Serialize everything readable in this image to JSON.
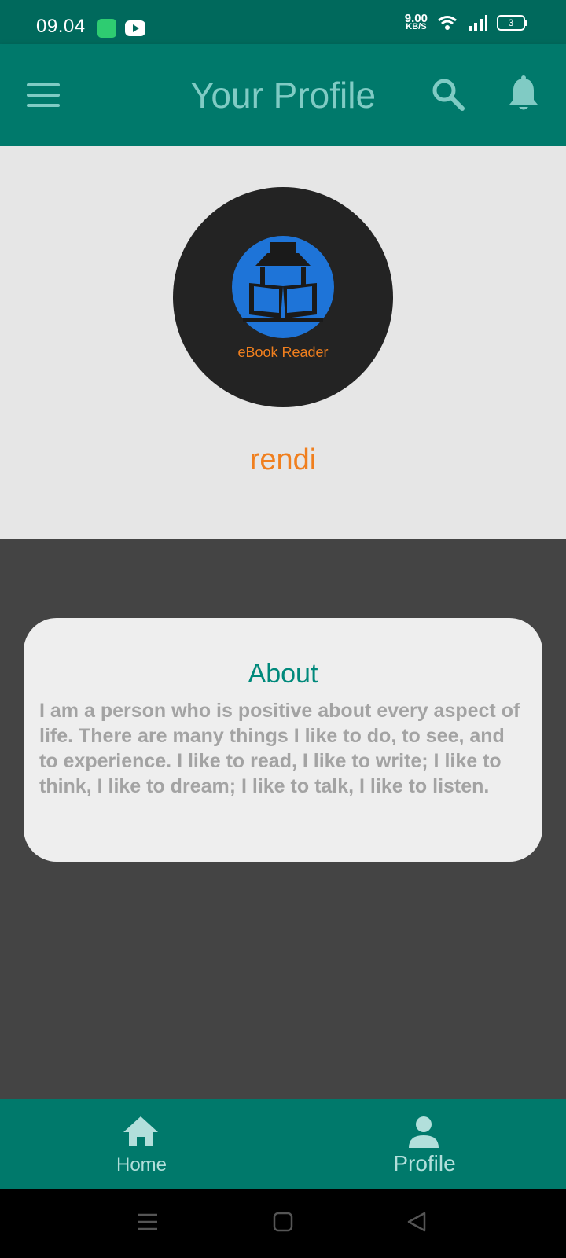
{
  "status_bar": {
    "time": "09.04",
    "net_speed_value": "9.00",
    "net_speed_unit": "KB/S",
    "battery": "3"
  },
  "app_bar": {
    "title": "Your Profile",
    "icons": [
      "menu-icon",
      "search-icon",
      "bell-icon"
    ]
  },
  "profile": {
    "avatar_caption": "eBook Reader",
    "username": "rendi"
  },
  "about": {
    "title": "About",
    "text": "I am a person who is positive about every aspect of life. There are many things I like to do, to see, and to experience. I like to read, I like to write; I like to think, I like to dream; I like to talk, I like to listen."
  },
  "bottom_nav": {
    "items": [
      {
        "label": "Home",
        "icon": "home-icon"
      },
      {
        "label": "Profile",
        "icon": "person-icon"
      }
    ]
  },
  "colors": {
    "primary": "#00796b",
    "status_bar": "#00695c",
    "accent_orange": "#f07f1e",
    "icon_tint": "#80cbc4",
    "body_dark": "#444444",
    "profile_bg": "#e6e6e6",
    "card_bg": "#eeeeee"
  }
}
